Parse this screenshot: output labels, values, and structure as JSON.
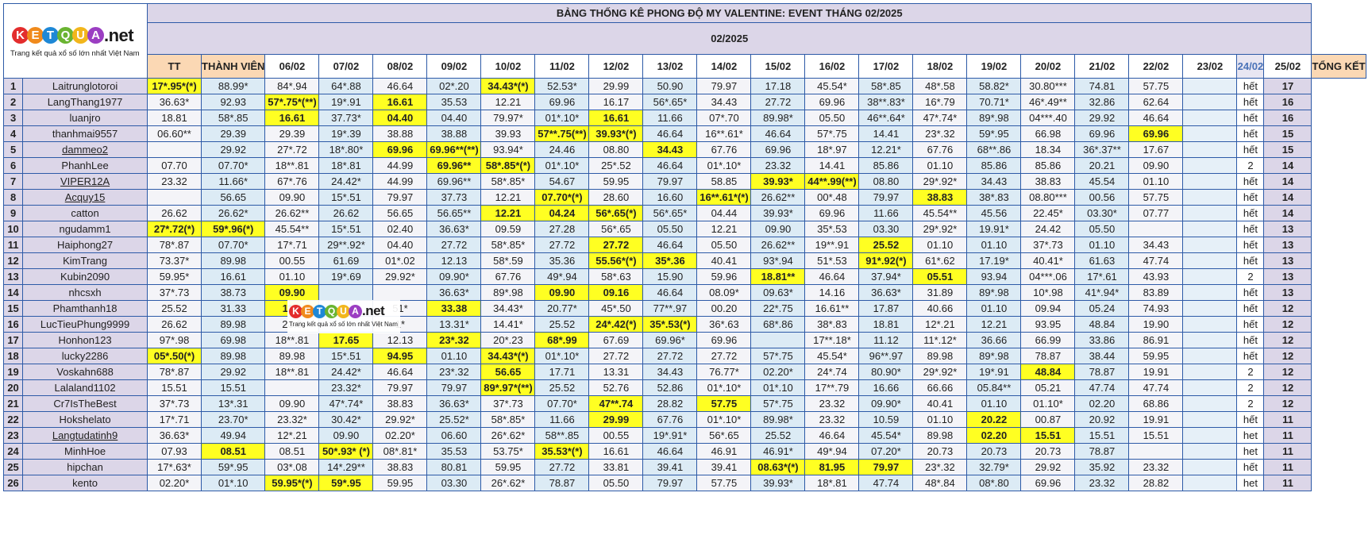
{
  "logo": {
    "letters": [
      "K",
      "E",
      "T",
      "Q",
      "U",
      "A"
    ],
    "suffix": ".net",
    "tagline": "Trang kết quả xổ số lớn nhất Việt Nam",
    "colors": [
      "#e32d2d",
      "#f08a1c",
      "#1e88d6",
      "#6ab431",
      "#f2b61c",
      "#9b3ec2"
    ]
  },
  "title": "BẢNG THỐNG KÊ PHONG ĐỘ MY VALENTINE: EVENT THÁNG 02/2025",
  "month": "02/2025",
  "headers": {
    "tt": "TT",
    "member": "THÀNH VIÊN",
    "total": "TỔNG KẾT",
    "dates": [
      "06/02",
      "07/02",
      "08/02",
      "09/02",
      "10/02",
      "11/02",
      "12/02",
      "13/02",
      "14/02",
      "15/02",
      "16/02",
      "17/02",
      "18/02",
      "19/02",
      "20/02",
      "21/02",
      "22/02",
      "23/02",
      "24/02",
      "25/02"
    ]
  },
  "colors": {
    "border": "#2d5aa7",
    "lavender": "#dcd6e8",
    "highlight": "#ffff22",
    "red_text": "#e01e1e",
    "header_orange": "#fbd8b4",
    "title_orange": "#e5702b"
  },
  "rows": [
    {
      "tt": "1",
      "name": "Laitrunglotoroi",
      "u": false,
      "cells": [
        "17*.95*(*)",
        "88.99*",
        "84*.94",
        "64*.88",
        "46.64",
        "02*.20",
        "34.43*(*)",
        "52.53*",
        "29.99",
        "50.90",
        "79.97",
        "17.18",
        "45.54*",
        "58*.85",
        "48*.58",
        "58.82*",
        "30.80***",
        "74.81",
        "57.75",
        ""
      ],
      "hl": [
        0,
        6
      ],
      "stat": "hết",
      "total": "17"
    },
    {
      "tt": "2",
      "name": "LangThang1977",
      "u": false,
      "cells": [
        "36.63*",
        "92.93",
        "57*.75*(**)",
        "19*.91",
        "16.61",
        "35.53",
        "12.21",
        "69.96",
        "16.17",
        "56*.65*",
        "34.43",
        "27.72",
        "69.96",
        "38**.83*",
        "16*.79",
        "70.71*",
        "46*.49**",
        "32.86",
        "62.64",
        ""
      ],
      "hl": [
        2,
        4
      ],
      "stat": "hết",
      "total": "16"
    },
    {
      "tt": "3",
      "name": "luanjro",
      "u": false,
      "cells": [
        "18.81",
        "58*.85",
        "16.61",
        "37.73*",
        "04.40",
        "04.40",
        "79.97*",
        "01*.10*",
        "16.61",
        "11.66",
        "07*.70",
        "89.98*",
        "05.50",
        "46**.64*",
        "47*.74*",
        "89*.98",
        "04***.40",
        "29.92",
        "46.64",
        ""
      ],
      "hl": [
        2,
        4,
        8
      ],
      "stat": "hết",
      "total": "16"
    },
    {
      "tt": "4",
      "name": "thanhmai9557",
      "u": false,
      "cells": [
        "06.60**",
        "29.39",
        "29.39",
        "19*.39",
        "38.88",
        "38.88",
        "39.93",
        "57**.75(**)",
        "39.93*(*)",
        "46.64",
        "16**.61*",
        "46.64",
        "57*.75",
        "14.41",
        "23*.32",
        "59*.95",
        "66.98",
        "69.96",
        "69.96",
        ""
      ],
      "hl": [
        7,
        8,
        18
      ],
      "stat": "hết",
      "total": "15"
    },
    {
      "tt": "5",
      "name": "dammeo2",
      "u": true,
      "cells": [
        "",
        "29.92",
        "27*.72",
        "18*.80*",
        "69.96",
        "69.96**(**)",
        "93.94*",
        "24.46",
        "08.80",
        "34.43",
        "67.76",
        "69.96",
        "18*.97",
        "12.21*",
        "67.76",
        "68**.86",
        "18.34",
        "36*.37**",
        "17.67",
        ""
      ],
      "hl": [
        4,
        5,
        9
      ],
      "stat": "hết",
      "total": "15"
    },
    {
      "tt": "6",
      "name": "PhanhLee",
      "u": false,
      "cells": [
        "07.70",
        "07.70*",
        "18**.81",
        "18*.81",
        "44.99",
        "69.96**",
        "58*.85*(*)",
        "01*.10*",
        "25*.52",
        "46.64",
        "01*.10*",
        "23.32",
        "14.41",
        "85.86",
        "01.10",
        "85.86",
        "85.86",
        "20.21",
        "09.90",
        ""
      ],
      "hl": [
        5,
        6
      ],
      "stat": "2",
      "total": "14"
    },
    {
      "tt": "7",
      "name": "VIPER12A",
      "u": true,
      "cells": [
        "23.32",
        "11.66*",
        "67*.76",
        "24.42*",
        "44.99",
        "69.96**",
        "58*.85*",
        "54.67",
        "59.95",
        "79.97",
        "58.85",
        "39.93*",
        "44**.99(**)",
        "08.80",
        "29*.92*",
        "34.43",
        "38.83",
        "45.54",
        "01.10",
        ""
      ],
      "hl": [
        11,
        12
      ],
      "stat": "hết",
      "total": "14"
    },
    {
      "tt": "8",
      "name": "Acquy15",
      "u": true,
      "cells": [
        "",
        "56.65",
        "09.90",
        "15*.51",
        "79.97",
        "37.73",
        "12.21",
        "07.70*(*)",
        "28.60",
        "16.60",
        "16**.61*(*)",
        "26.62**",
        "00*.48",
        "79.97",
        "38.83",
        "38*.83",
        "08.80***",
        "00.56",
        "57.75",
        ""
      ],
      "hl": [
        7,
        10,
        14
      ],
      "stat": "hết",
      "total": "14"
    },
    {
      "tt": "9",
      "name": "catton",
      "u": false,
      "cells": [
        "26.62",
        "26.62*",
        "26.62**",
        "26.62",
        "56.65",
        "56.65**",
        "12.21",
        "04.24",
        "56*.65(*)",
        "56*.65*",
        "04.44",
        "39.93*",
        "69.96",
        "11.66",
        "45.54**",
        "45.56",
        "22.45*",
        "03.30*",
        "07.77",
        ""
      ],
      "hl": [
        6,
        7,
        8
      ],
      "stat": "hết",
      "total": "14"
    },
    {
      "tt": "10",
      "name": "ngudamm1",
      "u": false,
      "cells": [
        "27*.72(*)",
        "59*.96(*)",
        "45.54**",
        "15*.51",
        "02.40",
        "36.63*",
        "09.59",
        "27.28",
        "56*.65",
        "05.50",
        "12.21",
        "09.90",
        "35*.53",
        "03.30",
        "29*.92*",
        "19.91*",
        "24.42",
        "05.50",
        "",
        ""
      ],
      "hl": [
        0,
        1
      ],
      "stat": "hết",
      "total": "13"
    },
    {
      "tt": "11",
      "name": "Haiphong27",
      "u": false,
      "cells": [
        "78*.87",
        "07.70*",
        "17*.71",
        "29**.92*",
        "04.40",
        "27.72",
        "58*.85*",
        "27.72",
        "27.72",
        "46.64",
        "05.50",
        "26.62**",
        "19**.91",
        "25.52",
        "01.10",
        "01.10",
        "37*.73",
        "01.10",
        "34.43",
        ""
      ],
      "hl": [
        8,
        13
      ],
      "stat": "hết",
      "total": "13"
    },
    {
      "tt": "12",
      "name": "KimTrang",
      "u": false,
      "cells": [
        "73.37*",
        "89.98",
        "00.55",
        "61.69",
        "01*.02",
        "12.13",
        "58*.59",
        "35.36",
        "55.56*(*)",
        "35*.36",
        "40.41",
        "93*.94",
        "51*.53",
        "91*.92(*)",
        "61*.62",
        "17.19*",
        "40.41*",
        "61.63",
        "47.74",
        ""
      ],
      "hl": [
        8,
        9,
        13
      ],
      "stat": "hết",
      "total": "13"
    },
    {
      "tt": "13",
      "name": "Kubin2090",
      "u": false,
      "cells": [
        "59.95*",
        "16.61",
        "01.10",
        "19*.69",
        "29.92*",
        "09.90*",
        "67.76",
        "49*.94",
        "58*.63",
        "15.90",
        "59.96",
        "18.81**",
        "46.64",
        "37.94*",
        "05.51",
        "93.94",
        "04***.06",
        "17*.61",
        "43.93",
        ""
      ],
      "hl": [
        11,
        14
      ],
      "stat": "2",
      "total": "13"
    },
    {
      "tt": "14",
      "name": "nhcsxh",
      "u": false,
      "cells": [
        "37*.73",
        "38.73",
        "09.90",
        "",
        "",
        "36.63*",
        "89*.98",
        "09.90",
        "09.16",
        "46.64",
        "08.09*",
        "09.63*",
        "14.16",
        "36.63*",
        "31.89",
        "89*.98",
        "10*.98",
        "41*.94*",
        "83.89",
        ""
      ],
      "hl": [
        2,
        7,
        8
      ],
      "stat": "hết",
      "total": "13"
    },
    {
      "tt": "15",
      "name": "Phamthanh18",
      "u": false,
      "cells": [
        "25.52",
        "31.33",
        "11.1",
        "",
        "51*",
        "33.38",
        "34.43*",
        "20.77*",
        "45*.50",
        "77**.97",
        "00.20",
        "22*.75",
        "16.61**",
        "17.87",
        "40.66",
        "01.10",
        "09.94",
        "05.24",
        "74.93",
        ""
      ],
      "hl": [
        2,
        5
      ],
      "stat": "hết",
      "total": "12"
    },
    {
      "tt": "16",
      "name": "LucTieuPhung9999",
      "u": false,
      "cells": [
        "26.62",
        "89.98",
        "28.8",
        "",
        "1*",
        "13.31*",
        "14.41*",
        "25.52",
        "24*.42(*)",
        "35*.53(*)",
        "36*.63",
        "68*.86",
        "38*.83",
        "18.81",
        "12*.21",
        "12.21",
        "93.95",
        "48.84",
        "19.90",
        ""
      ],
      "hl": [
        8,
        9
      ],
      "stat": "hết",
      "total": "12"
    },
    {
      "tt": "17",
      "name": "Honhon123",
      "u": false,
      "cells": [
        "97*.98",
        "69.98",
        "18**.81",
        "17.65",
        "12.13",
        "23*.32",
        "20*.23",
        "68*.99",
        "67.69",
        "69.96*",
        "69.96",
        "",
        "17**.18*",
        "11.12",
        "11*.12*",
        "36.66",
        "66.99",
        "33.86",
        "86.91",
        ""
      ],
      "hl": [
        3,
        5,
        7
      ],
      "stat": "hết",
      "total": "12"
    },
    {
      "tt": "18",
      "name": "lucky2286",
      "u": false,
      "cells": [
        "05*.50(*)",
        "89.98",
        "89.98",
        "15*.51",
        "94.95",
        "01.10",
        "34.43*(*)",
        "01*.10*",
        "27.72",
        "27.72",
        "27.72",
        "57*.75",
        "45.54*",
        "96**.97",
        "89.98",
        "89*.98",
        "78.87",
        "38.44",
        "59.95",
        ""
      ],
      "hl": [
        0,
        4,
        6
      ],
      "stat": "hết",
      "total": "12"
    },
    {
      "tt": "19",
      "name": "Voskahn688",
      "u": false,
      "cells": [
        "78*.87",
        "29.92",
        "18**.81",
        "24.42*",
        "46.64",
        "23*.32",
        "56.65",
        "17.71",
        "13.31",
        "34.43",
        "76.77*",
        "02.20*",
        "24*.74",
        "80.90*",
        "29*.92*",
        "19*.91",
        "48.84",
        "78.87",
        "19.91",
        ""
      ],
      "hl": [
        6,
        16
      ],
      "stat": "2",
      "total": "12"
    },
    {
      "tt": "20",
      "name": "Lalaland1102",
      "u": false,
      "cells": [
        "15.51",
        "15.51",
        "",
        "23.32*",
        "79.97",
        "79.97",
        "89*.97*(**)",
        "25.52",
        "52.76",
        "52.86",
        "01*.10*",
        "01*.10",
        "17**.79",
        "16.66",
        "66.66",
        "05.84**",
        "05.21",
        "47.74",
        "47.74",
        ""
      ],
      "hl": [
        6
      ],
      "stat": "2",
      "total": "12"
    },
    {
      "tt": "21",
      "name": "Cr7IsTheBest",
      "u": false,
      "cells": [
        "37*.73",
        "13*.31",
        "09.90",
        "47*.74*",
        "38.83",
        "36.63*",
        "37*.73",
        "07.70*",
        "47**.74",
        "28.82",
        "57.75",
        "57*.75",
        "23.32",
        "09.90*",
        "40.41",
        "01.10",
        "01.10*",
        "02.20",
        "68.86",
        ""
      ],
      "hl": [
        8,
        10
      ],
      "stat": "2",
      "total": "12"
    },
    {
      "tt": "22",
      "name": "Hokshelato",
      "u": false,
      "cells": [
        "17*.71",
        "23.70*",
        "23.32*",
        "30.42*",
        "29.92*",
        "25.52*",
        "58*.85*",
        "11.66",
        "29.99",
        "67.76",
        "01*.10*",
        "89.98*",
        "23.32",
        "10.59",
        "01.10",
        "20.22",
        "00.87",
        "20.92",
        "19.91",
        ""
      ],
      "hl": [
        8,
        15
      ],
      "stat": "hết",
      "total": "11"
    },
    {
      "tt": "23",
      "name": "Langtudatinh9",
      "u": true,
      "cells": [
        "36.63*",
        "49.94",
        "12*.21",
        "09.90",
        "02.20*",
        "06.60",
        "26*.62*",
        "58**.85",
        "00.55",
        "19*.91*",
        "56*.65",
        "25.52",
        "46.64",
        "45.54*",
        "89.98",
        "02.20",
        "15.51",
        "15.51",
        "15.51",
        ""
      ],
      "hl": [
        15,
        16
      ],
      "stat": "het",
      "total": "11"
    },
    {
      "tt": "24",
      "name": "MinhHoe",
      "u": false,
      "cells": [
        "07.93",
        "08.51",
        "08.51",
        "50*.93* (*)",
        "08*.81*",
        "35.53",
        "53.75*",
        "35.53*(*)",
        "16.61",
        "46.64",
        "46.91",
        "46.91*",
        "49*.94",
        "07.20*",
        "20.73",
        "20.73",
        "20.73",
        "78.87",
        "",
        ""
      ],
      "hl": [
        1,
        3,
        7
      ],
      "stat": "het",
      "total": "11"
    },
    {
      "tt": "25",
      "name": "hipchan",
      "u": false,
      "cells": [
        "17*.63*",
        "59*.95",
        "03*.08",
        "14*.29**",
        "38.83",
        "80.81",
        "59.95",
        "27.72",
        "33.81",
        "39.41",
        "39.41",
        "08.63*(*)",
        "81.95",
        "79.97",
        "23*.32",
        "32.79*",
        "29.92",
        "35.92",
        "23.32",
        ""
      ],
      "hl": [
        11,
        12,
        13
      ],
      "stat": "hết",
      "total": "11"
    },
    {
      "tt": "26",
      "name": "kento",
      "u": false,
      "cells": [
        "02.20*",
        "01*.10",
        "59.95*(*)",
        "59*.95",
        "59.95",
        "03.30",
        "26*.62*",
        "78.87",
        "05.50",
        "79.97",
        "57.75",
        "39.93*",
        "18*.81",
        "47.74",
        "48*.84",
        "08*.80",
        "69.96",
        "23.32",
        "28.82",
        ""
      ],
      "hl": [
        2,
        3
      ],
      "stat": "het",
      "total": "11"
    }
  ]
}
